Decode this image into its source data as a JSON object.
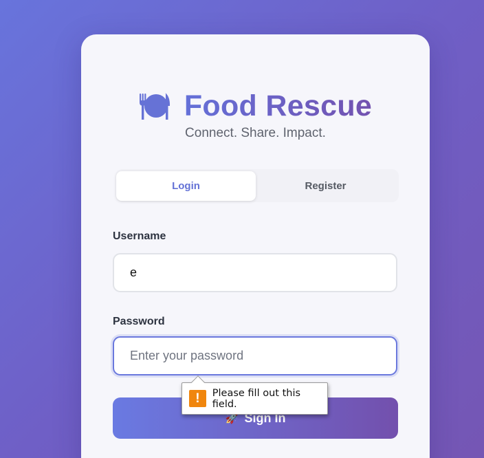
{
  "app": {
    "title": "Food Rescue",
    "tagline": "Connect. Share. Impact.",
    "logo_icon": "plate-utensils-icon"
  },
  "tabs": [
    {
      "label": "Login",
      "active": true
    },
    {
      "label": "Register",
      "active": false
    }
  ],
  "form": {
    "username": {
      "label": "Username",
      "value": "e",
      "placeholder": ""
    },
    "password": {
      "label": "Password",
      "value": "",
      "placeholder": "Enter your password"
    },
    "submit": {
      "label": "Sign In",
      "icon": "rocket-icon"
    }
  },
  "validation_tooltip": {
    "message": "Please fill out this field.",
    "icon": "warning-icon"
  },
  "colors": {
    "accent": "#6472d6",
    "gradient_start": "#6a7ae2",
    "gradient_end": "#7350ad",
    "warning": "#f0860e"
  }
}
